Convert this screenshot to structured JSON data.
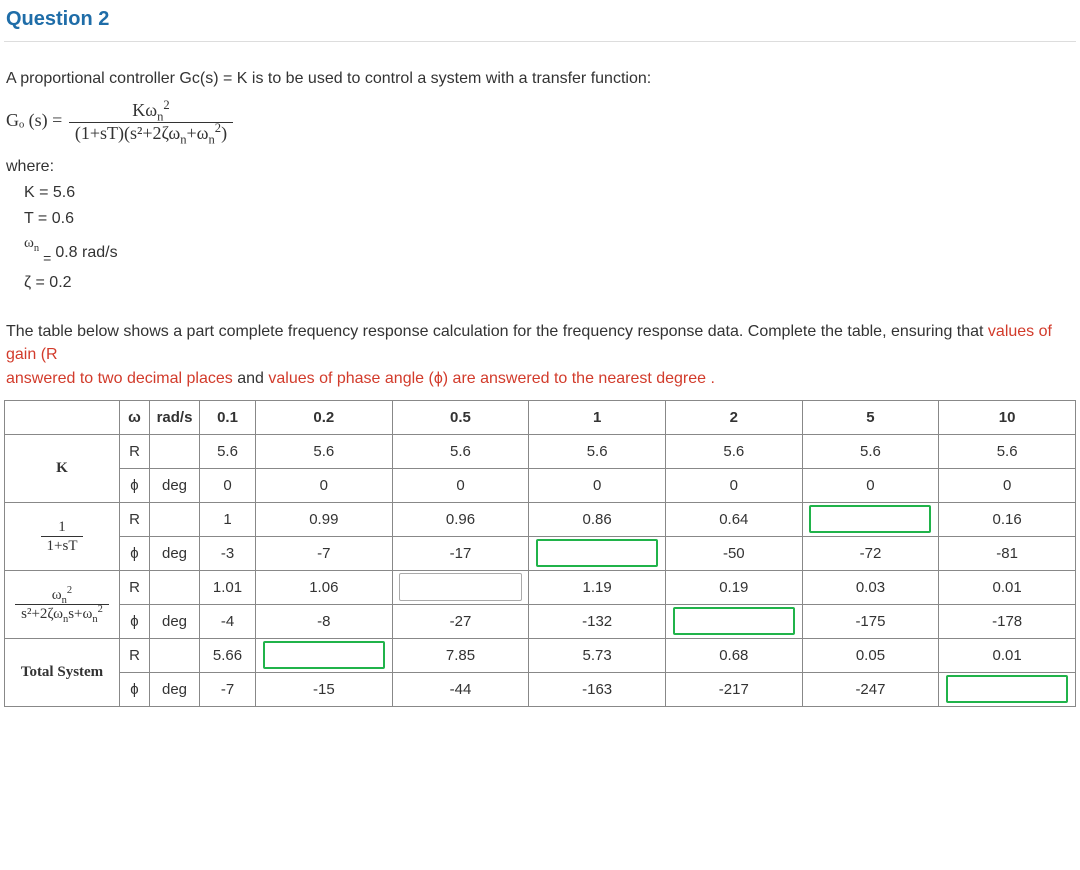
{
  "title": "Question 2",
  "intro": "A proportional controller Gc(s) = K is to be used to control a system with a transfer function:",
  "tf": {
    "lhs": "Gₒ (s) =",
    "num": "Kω",
    "den_a": "(1+sT)(s²+2ζω",
    "den_b": "+ω",
    "den_c": ")"
  },
  "where_label": "where:",
  "params": {
    "K": "K =  5.6",
    "T": "T =  0.6",
    "wn_sym": "ω",
    "wn_sub": "n",
    "wn_eq": "=",
    "wn_val": "0.8 rad/s",
    "zeta": "ζ =  0.2"
  },
  "instr_a": "The table below shows a part complete frequency response calculation for the frequency response data. Complete the table, ensuring that ",
  "instr_b": "values of gain (R",
  "instr_c": "answered to two decimal places",
  "instr_d": " and ",
  "instr_e": "values of phase angle (ϕ) are answered to the nearest degree .",
  "syms": {
    "omega": "ω",
    "R": "R",
    "phi": "ϕ"
  },
  "units": {
    "rads": "rad/s",
    "deg": "deg"
  },
  "heads": {
    "K": "K",
    "lag_num": "1",
    "lag_den": "1+sT",
    "so_num": "ω",
    "so_den_a": "s²+2ζω",
    "so_den_b": "s+ω",
    "total": "Total System"
  },
  "freqs": [
    "0.1",
    "0.2",
    "0.5",
    "1",
    "2",
    "5",
    "10"
  ],
  "rows": {
    "K_R": [
      "5.6",
      "5.6",
      "5.6",
      "5.6",
      "5.6",
      "5.6",
      "5.6"
    ],
    "K_phi": [
      "0",
      "0",
      "0",
      "0",
      "0",
      "0",
      "0"
    ],
    "lag_R": [
      "1",
      "0.99",
      "0.96",
      "0.86",
      "0.64",
      null,
      "0.16"
    ],
    "lag_phi": [
      "-3",
      "-7",
      "-17",
      null,
      "-50",
      "-72",
      "-81"
    ],
    "so_R": [
      "1.01",
      "1.06",
      null,
      "1.19",
      "0.19",
      "0.03",
      "0.01"
    ],
    "so_phi": [
      "-4",
      "-8",
      "-27",
      "-132",
      null,
      "-175",
      "-178"
    ],
    "tot_R": [
      "5.66",
      null,
      "7.85",
      "5.73",
      "0.68",
      "0.05",
      "0.01"
    ],
    "tot_phi": [
      "-7",
      "-15",
      "-44",
      "-163",
      "-217",
      "-247",
      null
    ]
  },
  "input_styles": {
    "lag_R_5": "green",
    "lag_phi_3": "green",
    "so_R_2": "gray",
    "so_phi_4": "green",
    "tot_R_1": "green",
    "tot_phi_6": "green"
  }
}
